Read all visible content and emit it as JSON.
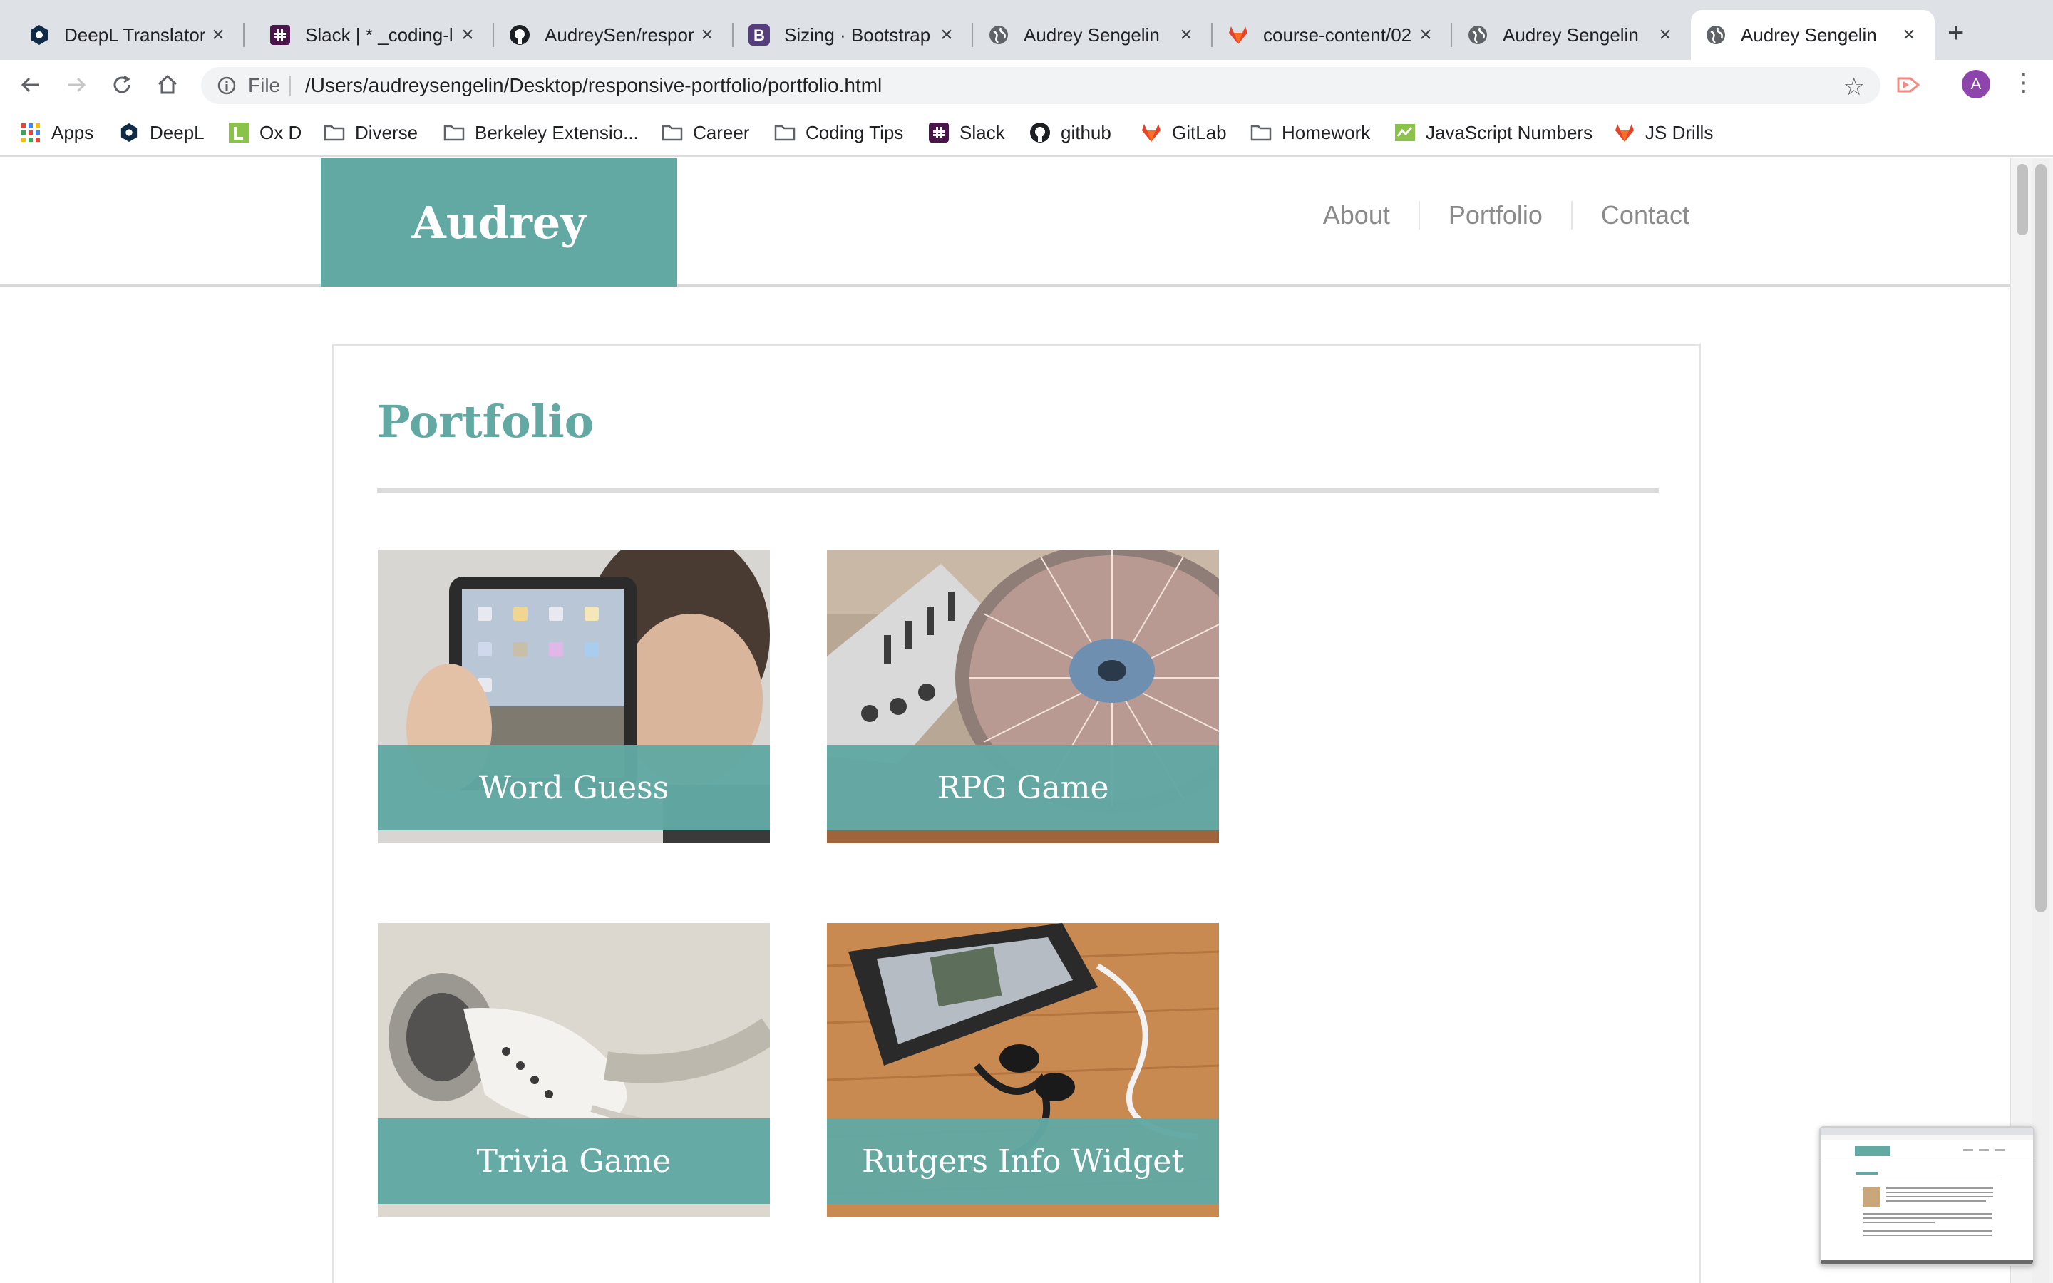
{
  "browser": {
    "tabs": [
      {
        "title": "DeepL Translator",
        "icon": "deepl-icon",
        "active": false
      },
      {
        "title": "Slack | * _coding-l",
        "icon": "slack-icon",
        "active": false
      },
      {
        "title": "AudreySen/respon",
        "icon": "github-icon",
        "active": false
      },
      {
        "title": "Sizing · Bootstrap",
        "icon": "bootstrap-icon",
        "active": false
      },
      {
        "title": "Audrey Sengelin",
        "icon": "globe-icon",
        "active": false
      },
      {
        "title": "course-content/02",
        "icon": "gitlab-icon",
        "active": false
      },
      {
        "title": "Audrey Sengelin",
        "icon": "globe-icon",
        "active": false
      },
      {
        "title": "Audrey Sengelin",
        "icon": "globe-icon",
        "active": true
      }
    ],
    "address": {
      "scheme": "File",
      "url": "/Users/audreysengelin/Desktop/responsive-portfolio/portfolio.html"
    },
    "profile_initial": "A",
    "bookmarks": [
      {
        "label": "Apps",
        "icon": "apps-grid-icon"
      },
      {
        "label": "DeepL",
        "icon": "deepl-icon"
      },
      {
        "label": "Ox D",
        "icon": "ox-d-icon"
      },
      {
        "label": "Diverse",
        "icon": "folder-icon"
      },
      {
        "label": "Berkeley Extensio...",
        "icon": "folder-icon"
      },
      {
        "label": "Career",
        "icon": "folder-icon"
      },
      {
        "label": "Coding Tips",
        "icon": "folder-icon"
      },
      {
        "label": "Slack",
        "icon": "slack-icon"
      },
      {
        "label": "github",
        "icon": "github-icon"
      },
      {
        "label": "GitLab",
        "icon": "gitlab-icon"
      },
      {
        "label": "Homework",
        "icon": "folder-icon"
      },
      {
        "label": "JavaScript Numbers",
        "icon": "js-numbers-icon"
      },
      {
        "label": "JS Drills",
        "icon": "gitlab-icon"
      }
    ]
  },
  "site": {
    "logo": "Audrey",
    "nav": [
      "About",
      "Portfolio",
      "Contact"
    ],
    "heading": "Portfolio",
    "projects": [
      {
        "title": "Word Guess",
        "image": "tablet-photo"
      },
      {
        "title": "RPG Game",
        "image": "turntable-photo"
      },
      {
        "title": "Trivia Game",
        "image": "earbuds-photo"
      },
      {
        "title": "Rutgers Info Widget",
        "image": "phone-headphones-photo"
      }
    ]
  },
  "colors": {
    "accent": "#62a8a3",
    "tabbar": "#dee1e6",
    "nav_text": "#8a8a8a"
  }
}
